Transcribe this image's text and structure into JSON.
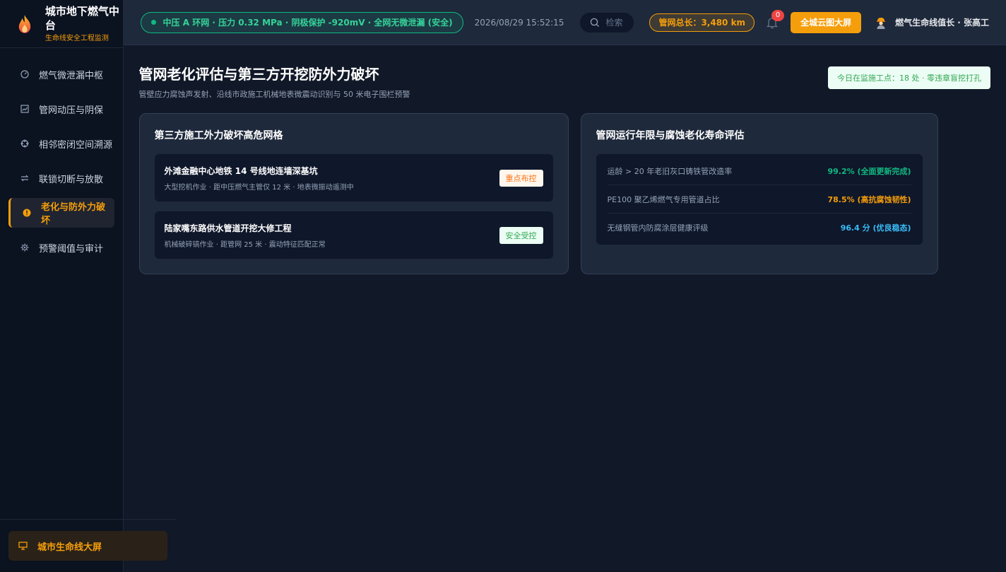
{
  "brand": {
    "title": "城市地下燃气中台",
    "subtitle": "生命线安全工程监测"
  },
  "sidebar": {
    "items": [
      {
        "label": "燃气微泄漏中枢",
        "icon": "gauge-icon",
        "active": false
      },
      {
        "label": "管网动压与阴保",
        "icon": "chart-icon",
        "active": false
      },
      {
        "label": "相邻密闭空间溯源",
        "icon": "crosshair-icon",
        "active": false
      },
      {
        "label": "联锁切断与放散",
        "icon": "switch-icon",
        "active": false
      },
      {
        "label": "老化与防外力破坏",
        "icon": "alert-icon",
        "active": true
      },
      {
        "label": "预警阈值与审计",
        "icon": "gear-icon",
        "active": false
      }
    ],
    "footer_label": "城市生命线大屏"
  },
  "topbar": {
    "status": "中压 A 环网 · 压力 0.32 MPa · 阴极保护 -920mV · 全网无微泄漏 (安全)",
    "datetime": "2026/08/29 15:52:15",
    "search_placeholder": "检索",
    "pipe_length": "管网总长：3,480 km",
    "notification_count": "0",
    "bigscreen_label": "全城云图大屏",
    "user": "燃气生命线值长 · 张高工"
  },
  "page": {
    "title": "管网老化评估与第三方开挖防外力破坏",
    "subtitle": "管壁应力腐蚀声发射、沿线市政施工机械地表微震动识别与 50 米电子围栏预警",
    "monitor_tag": "今日在监施工点：18 处 · 零违章盲挖打孔"
  },
  "left_card": {
    "title": "第三方施工外力破坏高危网格",
    "sites": [
      {
        "name": "外滩金融中心地铁 14 号线地连墙深基坑",
        "desc": "大型挖机作业 · 距中压燃气主管仅 12 米 · 地表微振动遥测中",
        "tag": "重点布控",
        "tag_type": "warn"
      },
      {
        "name": "陆家嘴东路供水管道开挖大修工程",
        "desc": "机械破碎镐作业 · 距管网 25 米 · 震动特征匹配正常",
        "tag": "安全受控",
        "tag_type": "safe"
      }
    ]
  },
  "right_card": {
    "title": "管网运行年限与腐蚀老化寿命评估",
    "metrics": [
      {
        "label": "运龄 > 20 年老旧灰口铸铁管改造率",
        "value": "99.2% (全面更新完成)",
        "color": "#10b981"
      },
      {
        "label": "PE100 聚乙烯燃气专用管道占比",
        "value": "78.5% (高抗腐蚀韧性)",
        "color": "#f59e0b"
      },
      {
        "label": "无缝钢管内防腐涂层健康评级",
        "value": "96.4 分 (优良稳态)",
        "color": "#38bdf8"
      }
    ]
  }
}
